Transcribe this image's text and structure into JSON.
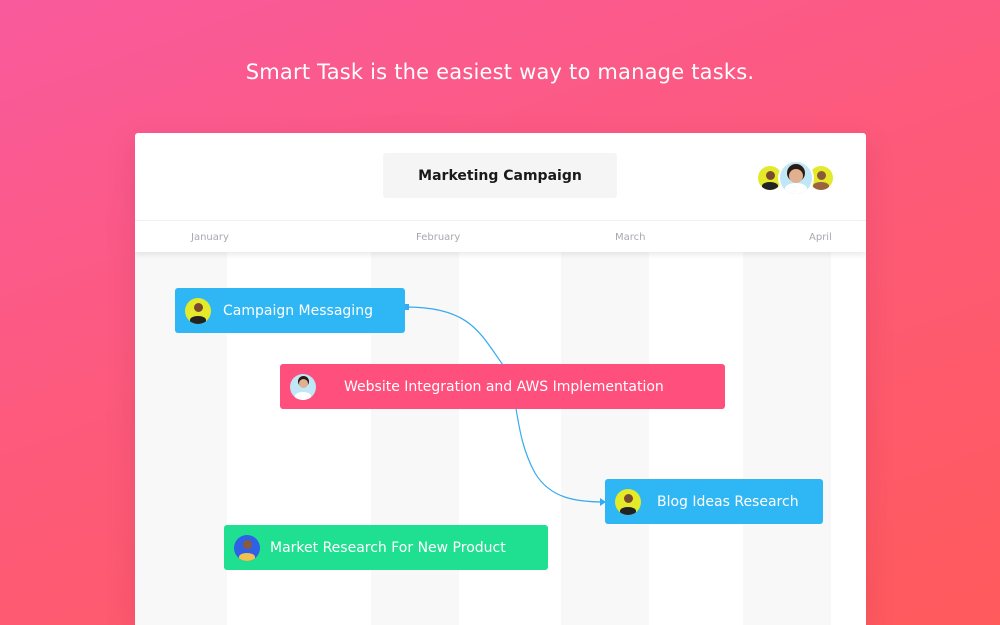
{
  "headline": "Smart Task is the easiest way to manage tasks.",
  "board": {
    "title": "Marketing Campaign",
    "months": [
      "January",
      "February",
      "March",
      "April"
    ]
  },
  "tasks": [
    {
      "label": "Campaign Messaging",
      "color": "#2eb6f5"
    },
    {
      "label": "Website Integration and AWS Implementation",
      "color": "#ff4f7d"
    },
    {
      "label": "Blog Ideas Research",
      "color": "#2eb6f5"
    },
    {
      "label": "Market Research For New Product",
      "color": "#1fe090"
    }
  ],
  "colors": {
    "link_line": "#36aaf0",
    "avatar_yellow": "#e4ea29",
    "avatar_blue": "#2f60e6",
    "avatar_light_blue": "#bfe7f5"
  }
}
